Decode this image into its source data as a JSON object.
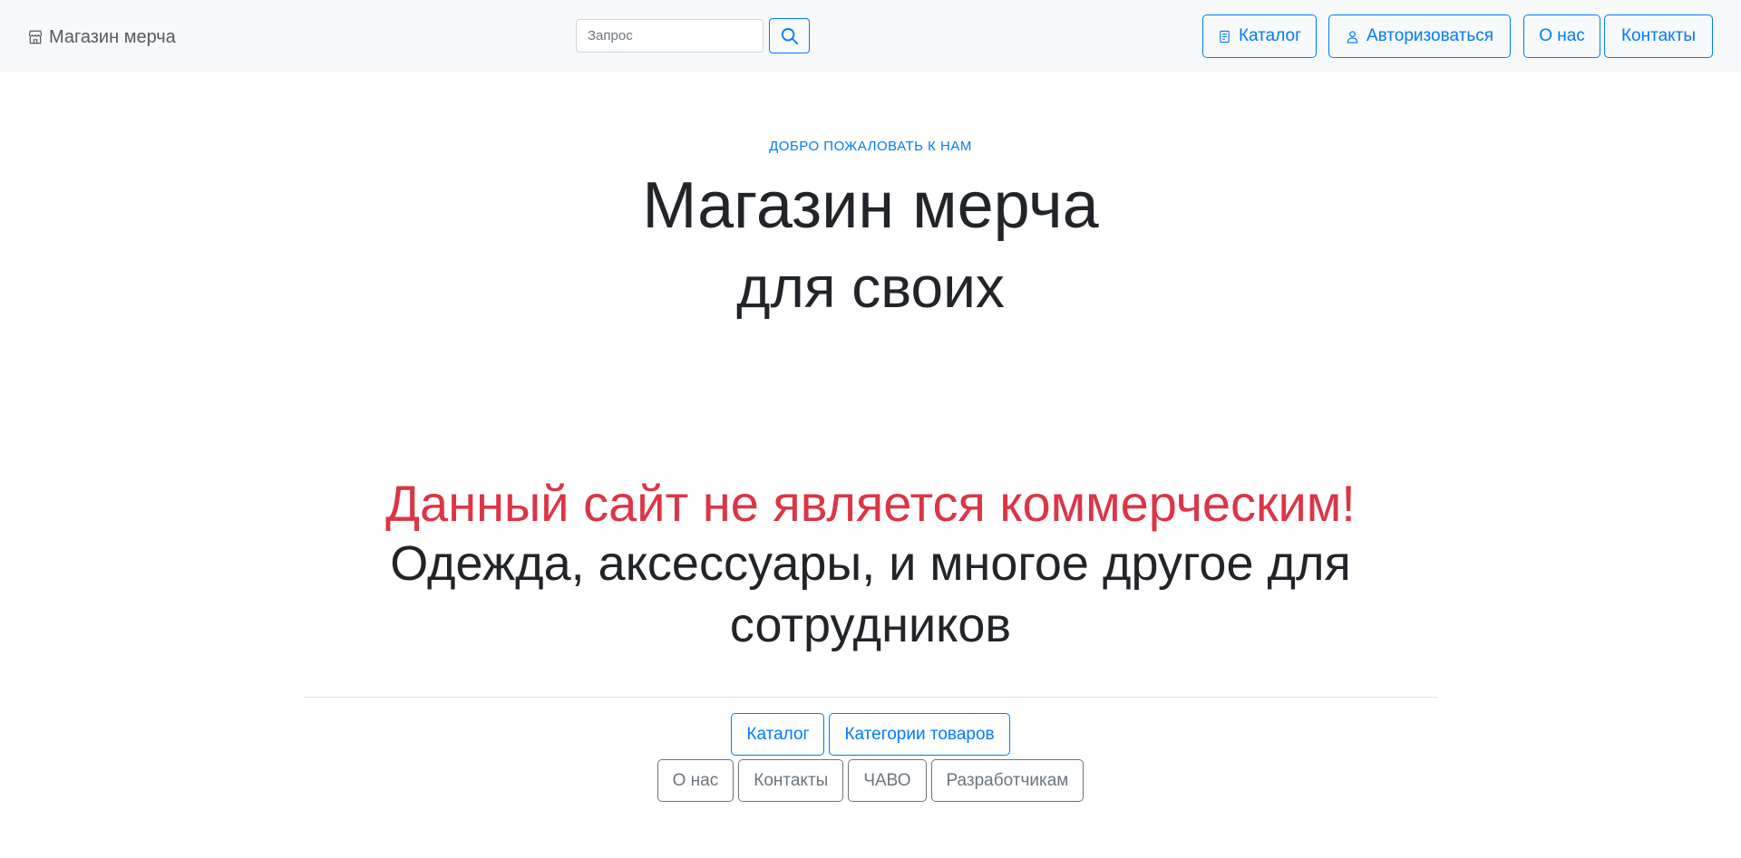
{
  "header": {
    "brand": "Магазин мерча",
    "search": {
      "placeholder": "Запрос",
      "value": ""
    },
    "nav": {
      "catalog": "Каталог",
      "login": "Авторизоваться",
      "about": "О нас",
      "contacts": "Контакты"
    }
  },
  "hero": {
    "welcome": "Добро пожаловать к нам",
    "line1": "Магазин мерча",
    "line2_prefix": "для ",
    "line2_bold": "своих"
  },
  "notice": {
    "text": "Данный сайт не является коммерческим!"
  },
  "tagline": {
    "part1": "Одежда, аксессуары, и ",
    "bold1": "многое",
    "part2": " другое для ",
    "bold2": "сотрудников"
  },
  "links": {
    "primary": [
      "Каталог",
      "Категории товаров"
    ],
    "secondary": [
      "О нас",
      "Контакты",
      "ЧАВО",
      "Разработчикам"
    ]
  },
  "colors": {
    "primary": "#007bff",
    "secondary": "#6c757d",
    "danger": "#dc3545",
    "navbar_bg": "#f8f9fa",
    "text": "#212529"
  },
  "icons": {
    "brand": "store-icon",
    "search": "search-icon",
    "catalog": "document-icon",
    "login": "user-icon"
  }
}
